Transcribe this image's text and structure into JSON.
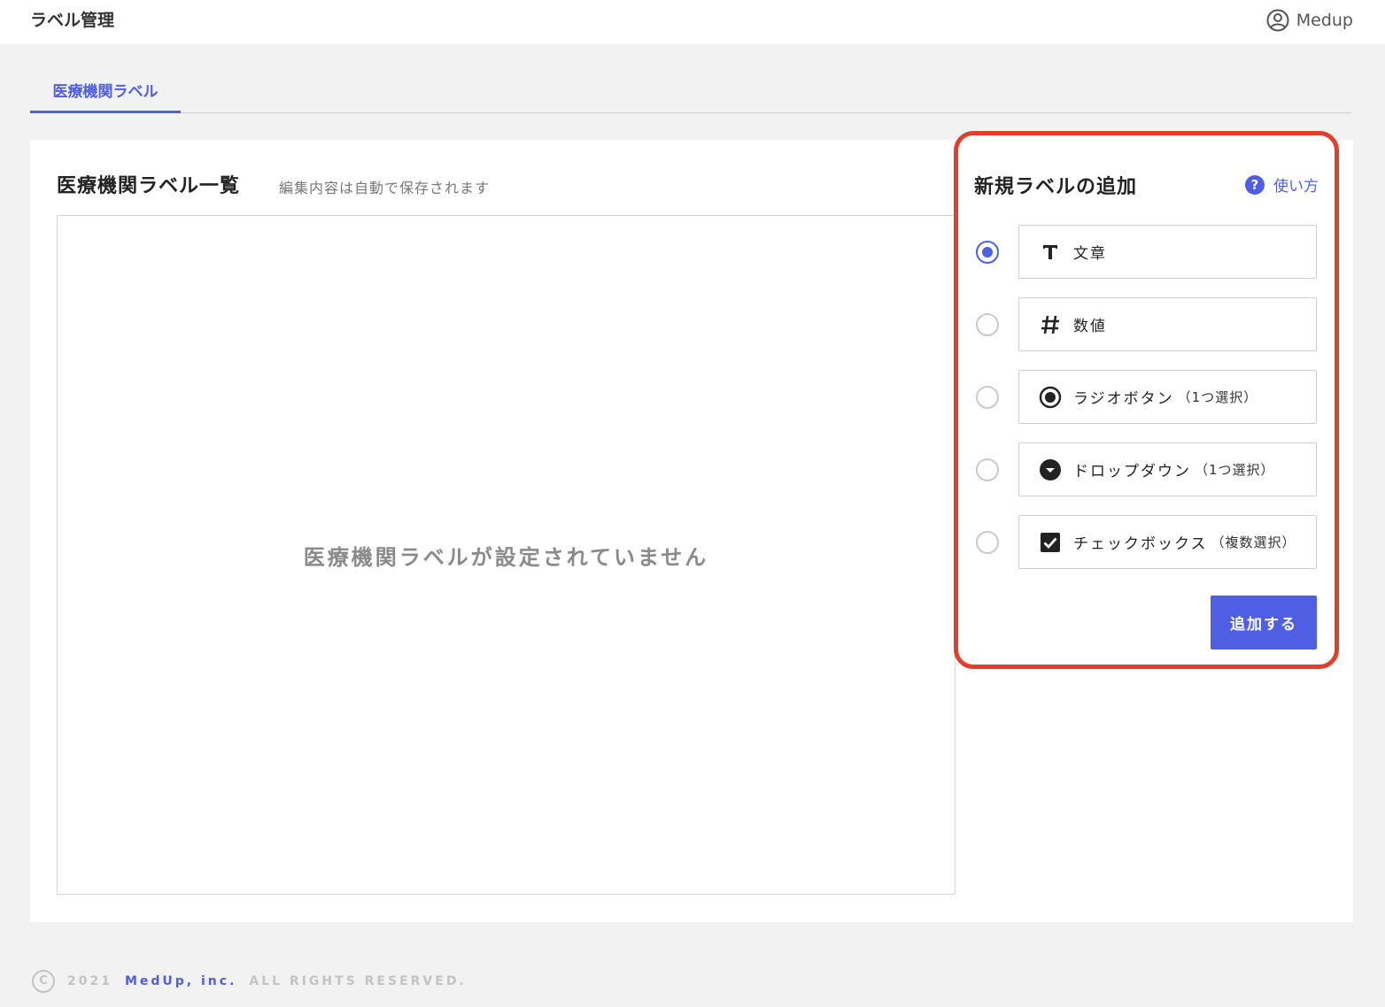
{
  "header": {
    "app_title": "ラベル管理",
    "user_name": "Medup"
  },
  "tabs": [
    {
      "label": "医療機関ラベル",
      "active": true
    }
  ],
  "list_panel": {
    "title": "医療機関ラベル一覧",
    "subtitle": "編集内容は自動で保存されます",
    "empty_message": "医療機関ラベルが設定されていません"
  },
  "add_panel": {
    "title": "新規ラベルの追加",
    "help_label": "使い方",
    "help_icon": "question-circle-icon",
    "options": [
      {
        "label": "文章",
        "note": "",
        "icon": "text-icon",
        "selected": true
      },
      {
        "label": "数値",
        "note": "",
        "icon": "hash-icon",
        "selected": false
      },
      {
        "label": "ラジオボタン",
        "note": "（1つ選択）",
        "icon": "radio-button-icon",
        "selected": false
      },
      {
        "label": "ドロップダウン",
        "note": "（1つ選択）",
        "icon": "dropdown-icon",
        "selected": false
      },
      {
        "label": "チェックボックス",
        "note": "（複数選択）",
        "icon": "checkbox-icon",
        "selected": false
      }
    ],
    "add_button_label": "追加する"
  },
  "footer": {
    "year": "2021",
    "company": "MedUp, inc.",
    "rights": "ALL RIGHTS RESERVED."
  },
  "colors": {
    "accent": "#4f5fe4",
    "highlight_border": "#e43d2c",
    "background": "#f2f2f2"
  }
}
